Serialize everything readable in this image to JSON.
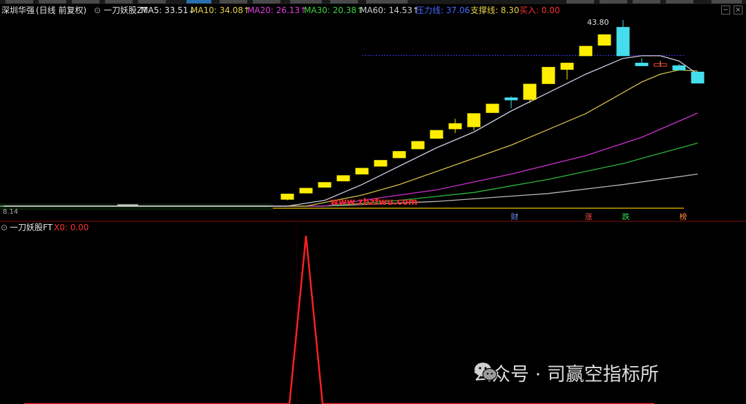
{
  "header": {
    "stock": "深圳华强",
    "period": "(日线 前复权)",
    "indicator": "一刀妖股ZT",
    "ma5": "MA5: 33.51↓",
    "ma10": "MA10: 34.08↑",
    "ma20": "MA20: 26.13↑",
    "ma30": "MA30: 20.38↑",
    "ma60": "MA60: 14.53↑",
    "resistance": "压力线: 37.06",
    "support": "支撑线: 8.30",
    "buy": "买入: 0.00"
  },
  "main_chart": {
    "high_label": "43.80",
    "low_label": "8.14",
    "markers": [
      {
        "text": "财",
        "color": "#6f8fff"
      },
      {
        "text": "涨",
        "color": "#ff4d4d"
      },
      {
        "text": "跌",
        "color": "#33dd55"
      },
      {
        "text": "榜",
        "color": "#ff8a3a"
      }
    ],
    "watermark_url": "www.zhzfwu.com"
  },
  "indicator_panel": {
    "name": "一刀妖股FT",
    "value": "X0: 0.00"
  },
  "footer": {
    "watermark": "公众号 · 司赢空指标所"
  },
  "chart_data": [
    {
      "type": "candlestick",
      "ylim": [
        8.14,
        43.8
      ],
      "colors": {
        "up": "#ffee00",
        "down": "#44ddee",
        "ma5": "#cfcfe8",
        "ma10": "#d6c24a",
        "ma20": "#d030d0",
        "ma30": "#2fb83a",
        "ma60": "#bbbbbb",
        "resistance": "#3a3aff",
        "support": "#c8a000"
      },
      "candles": [
        {
          "o": 9.7,
          "c": 10.7,
          "h": 10.7,
          "l": 9.5
        },
        {
          "o": 10.9,
          "c": 11.8,
          "h": 11.8,
          "l": 10.8
        },
        {
          "o": 12.0,
          "c": 12.9,
          "h": 12.9,
          "l": 12.0
        },
        {
          "o": 13.2,
          "c": 14.2,
          "h": 14.2,
          "l": 13.2
        },
        {
          "o": 14.5,
          "c": 15.6,
          "h": 15.6,
          "l": 14.5
        },
        {
          "o": 16.0,
          "c": 17.1,
          "h": 17.1,
          "l": 16.0
        },
        {
          "o": 17.6,
          "c": 18.8,
          "h": 18.8,
          "l": 17.6
        },
        {
          "o": 19.3,
          "c": 20.7,
          "h": 20.7,
          "l": 19.3
        },
        {
          "o": 21.3,
          "c": 22.8,
          "h": 22.8,
          "l": 21.3
        },
        {
          "o": 23.1,
          "c": 24.1,
          "h": 25.0,
          "l": 22.3
        },
        {
          "o": 23.5,
          "c": 26.0,
          "h": 26.0,
          "l": 22.8
        },
        {
          "o": 26.2,
          "c": 27.8,
          "h": 27.8,
          "l": 26.2
        },
        {
          "o": 29.0,
          "c": 28.6,
          "h": 29.3,
          "l": 27.0
        },
        {
          "o": 28.7,
          "c": 31.6,
          "h": 31.6,
          "l": 28.0
        },
        {
          "o": 31.7,
          "c": 34.8,
          "h": 34.8,
          "l": 31.7
        },
        {
          "o": 34.4,
          "c": 35.6,
          "h": 35.6,
          "l": 32.5
        },
        {
          "o": 37.0,
          "c": 38.8,
          "h": 38.8,
          "l": 37.0
        },
        {
          "o": 39.0,
          "c": 41.0,
          "h": 41.0,
          "l": 39.0
        },
        {
          "o": 42.4,
          "c": 37.0,
          "h": 43.8,
          "l": 37.0
        },
        {
          "o": 35.6,
          "c": 35.1,
          "h": 36.5,
          "l": 35.1
        },
        {
          "o": 35.0,
          "c": 35.5,
          "h": 36.0,
          "l": 35.0
        },
        {
          "o": 35.1,
          "c": 34.3,
          "h": 35.4,
          "l": 34.2
        },
        {
          "o": 33.9,
          "c": 31.8,
          "h": 33.9,
          "l": 31.8
        }
      ],
      "ma5": [
        [
          0,
          8.4
        ],
        [
          16,
          8.4
        ],
        [
          18,
          9.5
        ],
        [
          20,
          12.5
        ],
        [
          22,
          16.0
        ],
        [
          24,
          19.5
        ],
        [
          26,
          22.5
        ],
        [
          28,
          26.5
        ],
        [
          30,
          30.0
        ],
        [
          32,
          33.5
        ],
        [
          34,
          36.5
        ],
        [
          35,
          37.0
        ],
        [
          36,
          37.0
        ],
        [
          37,
          36.0
        ],
        [
          38,
          33.5
        ]
      ],
      "ma10": [
        [
          0,
          8.4
        ],
        [
          17,
          8.4
        ],
        [
          20,
          10.5
        ],
        [
          22,
          12.5
        ],
        [
          24,
          15.0
        ],
        [
          26,
          17.5
        ],
        [
          28,
          20.0
        ],
        [
          30,
          23.0
        ],
        [
          32,
          26.0
        ],
        [
          34,
          30.0
        ],
        [
          35,
          32.0
        ],
        [
          36,
          33.5
        ],
        [
          37,
          34.3
        ],
        [
          38,
          34.1
        ]
      ],
      "ma20": [
        [
          0,
          8.4
        ],
        [
          18,
          8.4
        ],
        [
          20,
          9.5
        ],
        [
          24,
          11.5
        ],
        [
          28,
          14.5
        ],
        [
          32,
          18.0
        ],
        [
          35,
          21.5
        ],
        [
          38,
          26.1
        ]
      ],
      "ma30": [
        [
          0,
          8.4
        ],
        [
          18,
          8.4
        ],
        [
          22,
          9.5
        ],
        [
          26,
          11.0
        ],
        [
          30,
          13.5
        ],
        [
          34,
          16.5
        ],
        [
          38,
          20.4
        ]
      ],
      "ma60": [
        [
          0,
          8.4
        ],
        [
          18,
          8.4
        ],
        [
          24,
          9.3
        ],
        [
          30,
          10.8
        ],
        [
          34,
          12.5
        ],
        [
          38,
          14.5
        ]
      ],
      "resistance": {
        "value": 37.06
      },
      "support": {
        "value": 8.3
      }
    },
    {
      "type": "line",
      "title": "一刀妖股FT",
      "ylim": [
        0,
        1
      ],
      "x": [
        0,
        16,
        17,
        18,
        38
      ],
      "values": [
        0,
        0,
        1,
        0,
        0
      ],
      "color": "#ff2020"
    }
  ]
}
